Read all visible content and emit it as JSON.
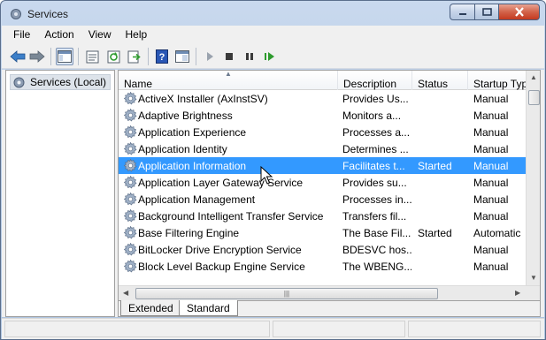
{
  "window": {
    "title": "Services"
  },
  "menu": [
    "File",
    "Action",
    "View",
    "Help"
  ],
  "toolbar_icons": [
    "back-arrow-icon",
    "forward-arrow-icon",
    "show-tree-icon",
    "properties-icon",
    "refresh-icon",
    "export-list-icon",
    "help-icon",
    "view-icon",
    "play-icon",
    "stop-icon",
    "pause-icon",
    "restart-icon"
  ],
  "tree": {
    "root_label": "Services (Local)"
  },
  "columns": {
    "name": "Name",
    "description": "Description",
    "status": "Status",
    "startup": "Startup Typ"
  },
  "rows": [
    {
      "name": "ActiveX Installer (AxInstSV)",
      "description": "Provides Us...",
      "status": "",
      "startup": "Manual"
    },
    {
      "name": "Adaptive Brightness",
      "description": "Monitors a...",
      "status": "",
      "startup": "Manual"
    },
    {
      "name": "Application Experience",
      "description": "Processes a...",
      "status": "",
      "startup": "Manual"
    },
    {
      "name": "Application Identity",
      "description": "Determines ...",
      "status": "",
      "startup": "Manual"
    },
    {
      "name": "Application Information",
      "description": "Facilitates t...",
      "status": "Started",
      "startup": "Manual",
      "selected": true
    },
    {
      "name": "Application Layer Gateway Service",
      "description": "Provides su...",
      "status": "",
      "startup": "Manual"
    },
    {
      "name": "Application Management",
      "description": "Processes in...",
      "status": "",
      "startup": "Manual"
    },
    {
      "name": "Background Intelligent Transfer Service",
      "description": "Transfers fil...",
      "status": "",
      "startup": "Manual"
    },
    {
      "name": "Base Filtering Engine",
      "description": "The Base Fil...",
      "status": "Started",
      "startup": "Automatic"
    },
    {
      "name": "BitLocker Drive Encryption Service",
      "description": "BDESVC hos...",
      "status": "",
      "startup": "Manual"
    },
    {
      "name": "Block Level Backup Engine Service",
      "description": "The WBENG...",
      "status": "",
      "startup": "Manual"
    }
  ],
  "tabs": {
    "extended": "Extended",
    "standard": "Standard"
  },
  "colors": {
    "selection": "#3399ff",
    "toolbar_green": "#2e9b2e"
  }
}
